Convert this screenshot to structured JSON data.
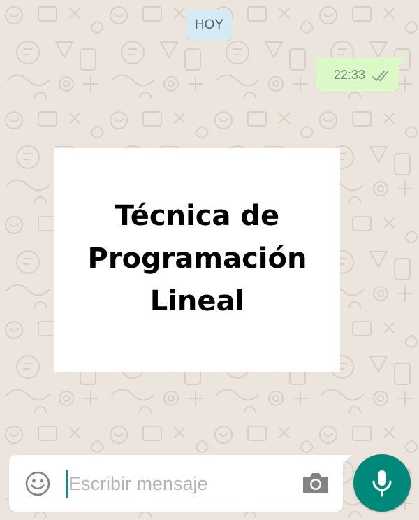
{
  "chat": {
    "date_label": "HOY",
    "messages": [
      {
        "direction": "outgoing",
        "time": "22:33",
        "status_icon": "double-check-icon",
        "image_text": "Técnica de Programación Lineal"
      }
    ]
  },
  "composer": {
    "placeholder": "Escribir mensaje",
    "value": "",
    "left_icon": "emoji-icon",
    "right_icon": "camera-icon",
    "send_icon": "microphone-icon"
  },
  "colors": {
    "wallpaper": "#ECE5DD",
    "date_chip": "#D4EAF4",
    "outgoing_bubble": "#DCF8C6",
    "accent": "#00897B"
  }
}
